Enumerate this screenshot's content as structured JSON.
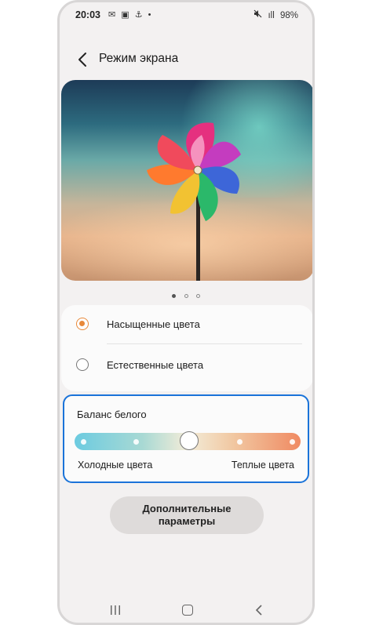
{
  "status_bar": {
    "time": "20:03",
    "left_icons": [
      "message-icon",
      "gallery-icon",
      "usb-icon",
      "dot"
    ],
    "left_icons_text": "✉ ▣ ⚓ •",
    "mute_icon": "🔇",
    "wifi_icon": "mute-wifi-signal-icon",
    "signal_text": "ıll",
    "battery": "98%"
  },
  "header": {
    "title": "Режим экрана"
  },
  "preview": {
    "page_count": 3,
    "active_page": 1
  },
  "screen_modes": {
    "options": [
      {
        "label": "Насыщенные цвета",
        "selected": true
      },
      {
        "label": "Естественные цвета",
        "selected": false
      }
    ],
    "accent_color": "#e8893a"
  },
  "white_balance": {
    "title": "Баланс белого",
    "cold_label": "Холодные цвета",
    "warm_label": "Теплые цвета",
    "level": 0.5,
    "highlight_color": "#1a73d9"
  },
  "more_button": {
    "line1": "Дополнительные",
    "line2": "параметры"
  },
  "nav_bar": {
    "icons": [
      "recent-apps-icon",
      "home-icon",
      "back-icon"
    ]
  }
}
